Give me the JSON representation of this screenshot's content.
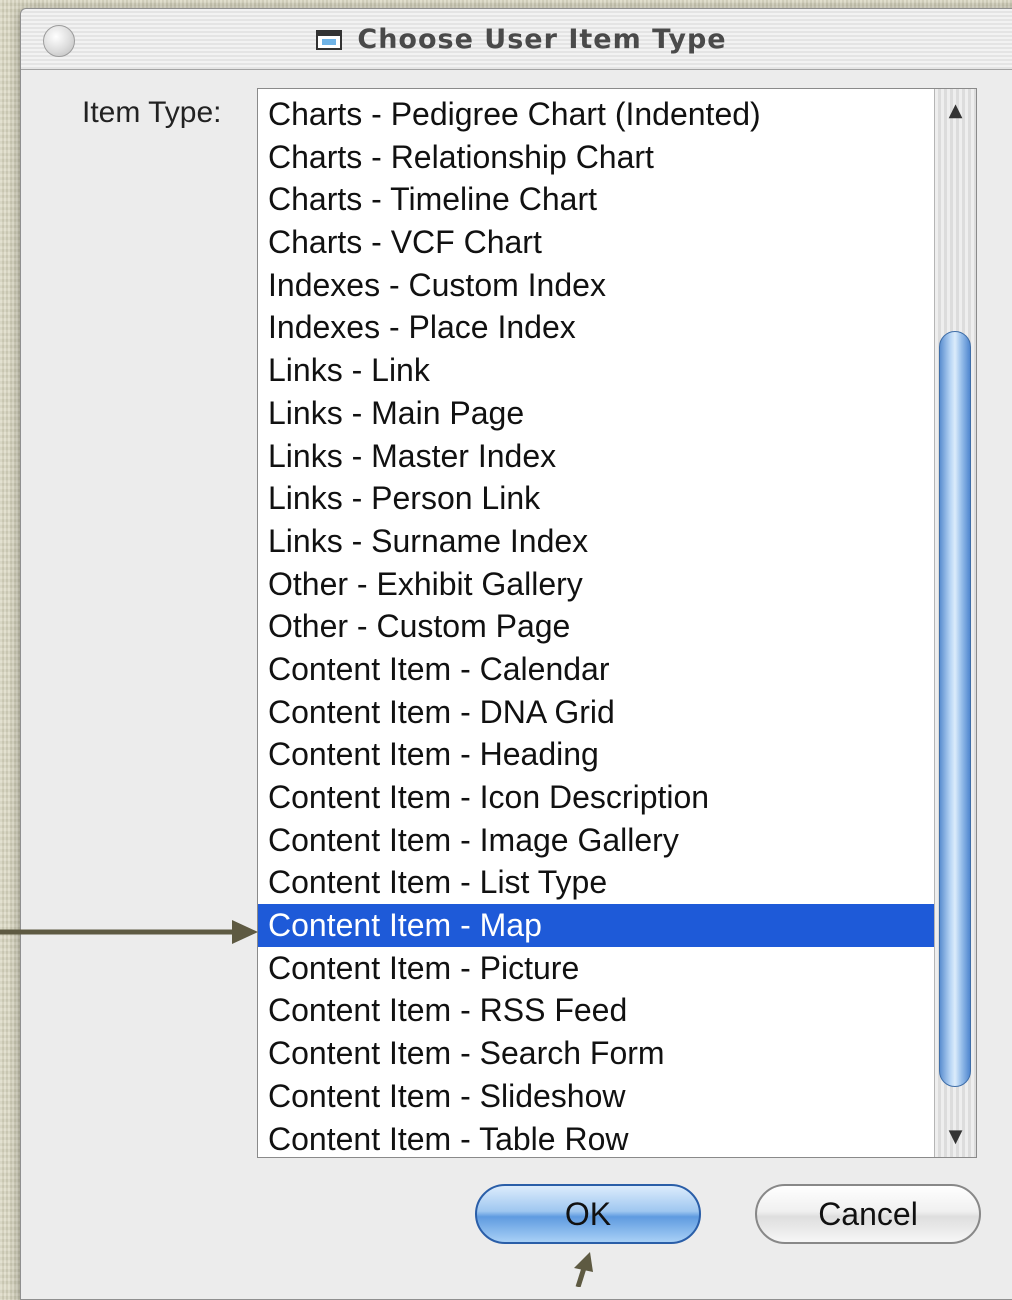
{
  "dialog": {
    "title": "Choose User Item Type",
    "field_label": "Item Type:",
    "items": [
      "Charts - Pedigree Chart (Indented)",
      "Charts - Relationship Chart",
      "Charts - Timeline Chart",
      "Charts - VCF Chart",
      "Indexes - Custom Index",
      "Indexes - Place Index",
      "Links - Link",
      "Links - Main Page",
      "Links - Master Index",
      "Links - Person Link",
      "Links - Surname Index",
      "Other - Exhibit Gallery",
      "Other - Custom Page",
      "Content Item - Calendar",
      "Content Item - DNA Grid",
      "Content Item - Heading",
      "Content Item - Icon Description",
      "Content Item - Image Gallery",
      "Content Item - List Type",
      "Content Item - Map",
      "Content Item - Picture",
      "Content Item - RSS Feed",
      "Content Item - Search Form",
      "Content Item - Slideshow",
      "Content Item - Table Row"
    ],
    "selected_item": "Content Item - Map",
    "ok_label": "OK",
    "cancel_label": "Cancel"
  },
  "colors": {
    "selection": "#1e5ad8",
    "annotation_arrow": "#5e5a42",
    "background": "#d8d5be"
  }
}
